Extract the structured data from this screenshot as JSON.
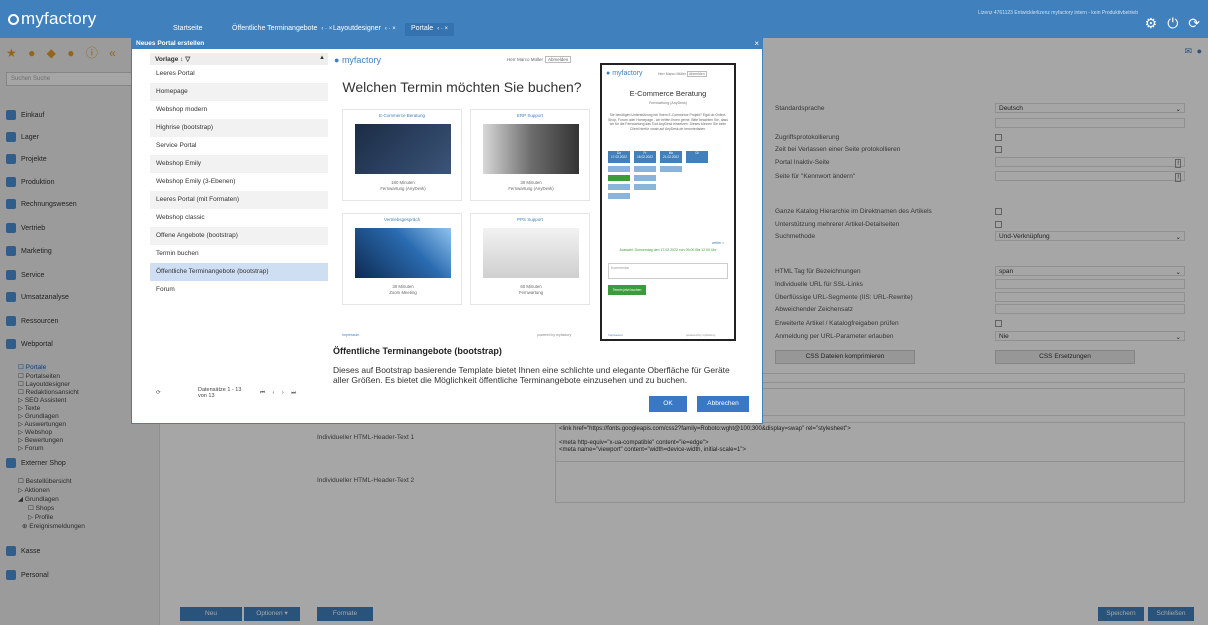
{
  "app": {
    "logo": "myfactory",
    "tabs": [
      {
        "label": "Startseite"
      },
      {
        "label": "Öffentliche Terminangebote"
      },
      {
        "label": "Layoutdesigner"
      },
      {
        "label": "Portale"
      }
    ],
    "license_info": "Lizenz 4761123 Entwicklerlizenz myfactory intern - kein Produktivbetrieb"
  },
  "sidebar": {
    "search_placeholder": "Suchen Suche",
    "items": [
      {
        "label": "Einkauf",
        "color": "#4a8fd4"
      },
      {
        "label": "Lager",
        "color": "#4a8fd4"
      },
      {
        "label": "Projekte",
        "color": "#4a8fd4"
      },
      {
        "label": "Produktion",
        "color": "#4a8fd4"
      },
      {
        "label": "Rechnungswesen",
        "color": "#4a8fd4"
      },
      {
        "label": "Vertrieb",
        "color": "#4a8fd4"
      },
      {
        "label": "Marketing",
        "color": "#4a8fd4"
      },
      {
        "label": "Service",
        "color": "#4a8fd4"
      },
      {
        "label": "Umsatzanalyse",
        "color": "#4a8fd4"
      },
      {
        "label": "Ressourcen",
        "color": "#4a8fd4"
      },
      {
        "label": "Webportal",
        "color": "#4a8fd4"
      },
      {
        "label": "Externer Shop",
        "color": "#4a8fd4"
      },
      {
        "label": "Kasse",
        "color": "#4a8fd4"
      },
      {
        "label": "Personal",
        "color": "#4a8fd4"
      }
    ],
    "webportal_sub": [
      "Portale",
      "Portalseiten",
      "Layoutdesigner",
      "Redaktionsansicht",
      "SEO Assistent",
      "Texte",
      "Grundlagen",
      "Auswertungen",
      "Webshop",
      "Bewertungen",
      "Forum"
    ],
    "shop_sub": [
      "Bestellübersicht",
      "Aktionen",
      "Grundlagen",
      "Shops",
      "Profile",
      "Ereignismeldungen"
    ]
  },
  "form": {
    "standardsprache_label": "Standardsprache",
    "standardsprache_value": "Deutsch",
    "zugriff_label": "Zugriffsprotokollierung",
    "zeit_label": "Zeit bei Verlassen einer Seite protokollieren",
    "inaktiv_label": "Portal Inaktiv-Seite",
    "kennwort_label": "Seite für \"Kennwort ändern\"",
    "katalog_label": "Ganze Katalog Hierarchie im Direktnamen des Artikels",
    "artikel_label": "Unterstützung mehrerer Artikel-Detailseiten",
    "suchmethode_label": "Suchmethode",
    "suchmethode_value": "Und-Verknüpfung",
    "htmltag_label": "HTML Tag für Bezeichnungen",
    "htmltag_value": "span",
    "ssl_label": "Individuelle URL für SSL-Links",
    "url_label": "Überflüssige URL-Segmente (IIS: URL-Rewrite)",
    "zeichensatz_label": "Abweichender Zeichensatz",
    "erweitert_label": "Erweiterte Artikel / Katalogfreigaben prüfen",
    "anmeldung_label": "Anmeldung per URL-Parameter erlauben",
    "anmeldung_value": "Nie",
    "css_btn": "CSS Dateien komprimieren",
    "css_ers_btn": "CSS Ersetzungen",
    "header1_label": "Individueller HTML-Header-Text 1",
    "header1_value": "<link href=\"https://fonts.googleapis.com/css2?family=Roboto:wght@100;300&display=swap\" rel=\"stylesheet\">\n\n<meta http-equiv=\"x-ua-compatible\" content=\"ie=edge\">\n<meta name=\"viewport\" content=\"width=device-width, initial-scale=1\">",
    "header2_label": "Individueller HTML-Header-Text 2"
  },
  "footer": {
    "neu": "Neu",
    "optionen": "Optionen",
    "formate": "Formate",
    "speichern": "Speichern",
    "schliessen": "Schließen"
  },
  "dialog": {
    "title": "Neues Portal erstellen",
    "list_header": "Vorlage",
    "templates": [
      "Leeres Portal",
      "Homepage",
      "Webshop modern",
      "Highrise (bootstrap)",
      "Service Portal",
      "Webshop Emily",
      "Webshop Emily (3-Ebenen)",
      "Leeres Portal (mit Formaten)",
      "Webshop classic",
      "Offene Angebote (bootstrap)",
      "Termin buchen",
      "Öffentliche Terminangebote (bootstrap)",
      "Forum"
    ],
    "selected_index": 11,
    "pager_text": "Datensätze 1 - 13 von 13",
    "preview": {
      "logo": "myfactory",
      "user": "Herr Marco Müller",
      "logout": "Abmelden",
      "heading": "Welchen Termin möchten Sie buchen?",
      "cards": [
        {
          "title": "E-Commerce Beratung",
          "desc": "180 Minuten\nFernwartung (AnyDesk)"
        },
        {
          "title": "ERP Support",
          "desc": "30 Minuten\nFernwartung (AnyDesk)"
        },
        {
          "title": "Vertriebsgespräch",
          "desc": "30 Minuten\nZoom Meeting"
        },
        {
          "title": "PPS Support",
          "desc": "60 Minuten\nFernwartung"
        }
      ],
      "footer_left": "Impressum",
      "footer_right": "powered by myfactory",
      "mobile": {
        "title": "E-Commerce Beratung",
        "subtitle": "Fernwartung (AnyDesk)",
        "text": "Sie benötigen Unterstützung bei Ihrem E-Commerce Projekt? Egal ob Online-Shop, Forum oder Homepage - wir helfen Ihnen gerne. Bitte beachten Sie, dass wir für die Fernwartung das Tool AnyDesk einsetzen. Dieses können Sie beim Client hierfür vorab auf AnyDesk.de herunterladen.",
        "dates": [
          "Do\n17.02.2022",
          "Fr\n18.02.2022",
          "Mo\n21.02.2022",
          "Di"
        ],
        "more": "weiter >",
        "selected": "Auswahl: Donnerstag den 17.02.2022 von 09:00 Bis 12:00 Uhr",
        "comment": "Kommentar",
        "book_btn": "Termin jetzt buchen",
        "footer_left": "Impressum",
        "footer_right": "powered by myfactory"
      }
    },
    "desc_title": "Öffentliche Terminangebote (bootstrap)",
    "desc_text": "Dieses auf Bootstrap basierende Template bietet Ihnen eine schlichte und elegante Oberfläche für Geräte aller Größen. Es bietet die Möglichkeit öffentliche Terminangebote einzusehen und zu buchen.",
    "ok": "OK",
    "cancel": "Abbrechen"
  }
}
